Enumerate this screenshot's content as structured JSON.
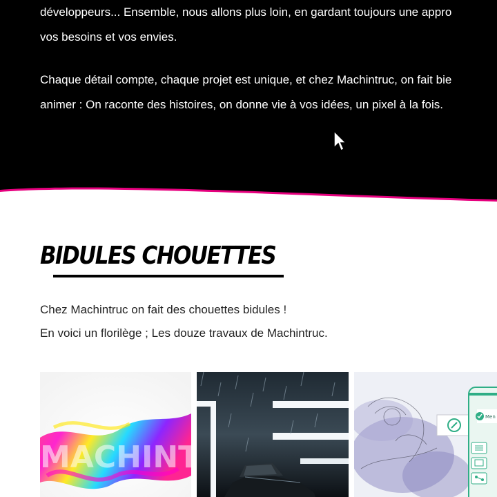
{
  "hero": {
    "line1": "développeurs... Ensemble, nous allons plus loin, en gardant toujours une appro",
    "line2": "vos besoins et vos envies.",
    "line3": "Chaque détail compte, chaque projet est unique, et chez Machintruc, on fait bie",
    "line4": "animer : On raconte des histoires, on donne vie à vos idées, un pixel à la fois."
  },
  "section": {
    "title": "BIDULES CHOUETTES",
    "intro_line1": "Chez Machintruc on fait des chouettes bidules !",
    "intro_line2": "En voici un florilège ; Les douze travaux de Machintruc."
  },
  "gallery": {
    "tile1_art_text": "MACHINTRUC",
    "tile3_app_label": "Men"
  },
  "colors": {
    "hero_bg": "#000000",
    "accent_wave": "#e6007e",
    "app_green": "#2fae86"
  },
  "icons": {
    "cursor": "mouse-pointer-icon",
    "tile3_buttons": [
      "check-circle-icon",
      "compass-icon",
      "list-icon",
      "calendar-icon",
      "network-icon"
    ]
  }
}
